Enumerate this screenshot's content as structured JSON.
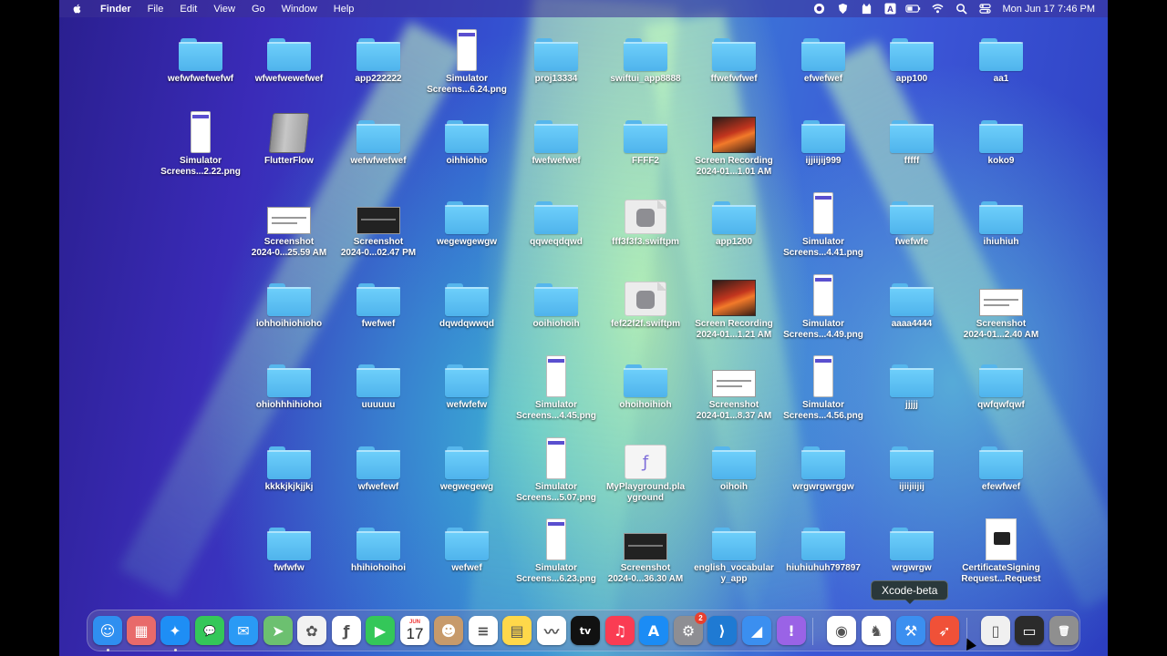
{
  "menubar": {
    "app_name": "Finder",
    "menus": [
      "File",
      "Edit",
      "View",
      "Go",
      "Window",
      "Help"
    ],
    "status_icons": [
      "record-icon",
      "shield-icon",
      "cat-icon",
      "input-source-icon",
      "battery-icon",
      "wifi-icon",
      "search-icon",
      "control-center-icon"
    ],
    "input_source": "A",
    "clock": "Mon Jun 17  7:46 PM"
  },
  "desktop": {
    "items": [
      {
        "label": "wefwfwefwefwf",
        "kind": "folder"
      },
      {
        "label": "wfwefwewefwef",
        "kind": "folder"
      },
      {
        "label": "app222222",
        "kind": "folder"
      },
      {
        "label": "Simulator\nScreens...6.24.png",
        "kind": "phone"
      },
      {
        "label": "proj13334",
        "kind": "folder"
      },
      {
        "label": "swiftui_app8888",
        "kind": "folder"
      },
      {
        "label": "ffwefwfwef",
        "kind": "folder"
      },
      {
        "label": "efwefwef",
        "kind": "folder"
      },
      {
        "label": "app100",
        "kind": "folder"
      },
      {
        "label": "aa1",
        "kind": "folder"
      },
      {
        "label": "Simulator\nScreens...2.22.png",
        "kind": "phone"
      },
      {
        "label": "FlutterFlow",
        "kind": "drive"
      },
      {
        "label": "wefwfwefwef",
        "kind": "folder"
      },
      {
        "label": "oihhiohio",
        "kind": "folder"
      },
      {
        "label": "fwefwefwef",
        "kind": "folder"
      },
      {
        "label": "FFFF2",
        "kind": "folder"
      },
      {
        "label": "Screen Recording\n2024-01...1.01 AM",
        "kind": "recording"
      },
      {
        "label": "ijjiijij999",
        "kind": "folder"
      },
      {
        "label": "fffff",
        "kind": "folder"
      },
      {
        "label": "koko9",
        "kind": "folder"
      },
      {
        "label": "Screenshot\n2024-0...25.59 AM",
        "kind": "screenshot"
      },
      {
        "label": "Screenshot\n2024-0...02.47 PM",
        "kind": "screenshot-dark"
      },
      {
        "label": "wegewgewgw",
        "kind": "folder"
      },
      {
        "label": "qqweqdqwd",
        "kind": "folder"
      },
      {
        "label": "fff3f3f3.swiftpm",
        "kind": "swiftpm"
      },
      {
        "label": "app1200",
        "kind": "folder"
      },
      {
        "label": "Simulator\nScreens...4.41.png",
        "kind": "phone"
      },
      {
        "label": "fwefwfe",
        "kind": "folder"
      },
      {
        "label": "ihiuhiuh",
        "kind": "folder"
      },
      {
        "label": "iohhoihiohioho",
        "kind": "folder"
      },
      {
        "label": "fwefwef",
        "kind": "folder"
      },
      {
        "label": "dqwdqwwqd",
        "kind": "folder"
      },
      {
        "label": "ooihiohoih",
        "kind": "folder"
      },
      {
        "label": "fef22f2f.swiftpm",
        "kind": "swiftpm"
      },
      {
        "label": "Screen Recording\n2024-01...1.21 AM",
        "kind": "recording"
      },
      {
        "label": "Simulator\nScreens...4.49.png",
        "kind": "phone"
      },
      {
        "label": "aaaa4444",
        "kind": "folder"
      },
      {
        "label": "Screenshot\n2024-01...2.40 AM",
        "kind": "screenshot"
      },
      {
        "label": "ohiohhhihiohoi",
        "kind": "folder"
      },
      {
        "label": "uuuuuu",
        "kind": "folder"
      },
      {
        "label": "wefwfefw",
        "kind": "folder"
      },
      {
        "label": "Simulator\nScreens...4.45.png",
        "kind": "phone"
      },
      {
        "label": "ohoihoihioh",
        "kind": "folder"
      },
      {
        "label": "Screenshot\n2024-01...8.37 AM",
        "kind": "screenshot"
      },
      {
        "label": "Simulator\nScreens...4.56.png",
        "kind": "phone"
      },
      {
        "label": "jjjjj",
        "kind": "folder"
      },
      {
        "label": "qwfqwfqwf",
        "kind": "folder"
      },
      {
        "label": "kkkkjkjkjjkj",
        "kind": "folder"
      },
      {
        "label": "wfwefewf",
        "kind": "folder"
      },
      {
        "label": "wegwegewg",
        "kind": "folder"
      },
      {
        "label": "Simulator\nScreens...5.07.png",
        "kind": "phone"
      },
      {
        "label": "MyPlayground.pla\nyground",
        "kind": "playground"
      },
      {
        "label": "oihoih",
        "kind": "folder"
      },
      {
        "label": "wrgwrgwrggw",
        "kind": "folder"
      },
      {
        "label": "ijiijiijij",
        "kind": "folder"
      },
      {
        "label": "efewfwef",
        "kind": "folder"
      },
      {
        "label": "fwfwfw",
        "kind": "folder"
      },
      {
        "label": "hhihiohoihoi",
        "kind": "folder"
      },
      {
        "label": "wefwef",
        "kind": "folder"
      },
      {
        "label": "Simulator\nScreens...6.23.png",
        "kind": "phone"
      },
      {
        "label": "Screenshot\n2024-0...36.30 AM",
        "kind": "screenshot-dark"
      },
      {
        "label": "english_vocabular\ny_app",
        "kind": "folder"
      },
      {
        "label": "hiuhiuhuh797897",
        "kind": "folder"
      },
      {
        "label": "wrgwrgw",
        "kind": "folder"
      },
      {
        "label": "CertificateSigning\nRequest...Request",
        "kind": "certificate"
      }
    ]
  },
  "tooltip": "Xcode-beta",
  "dock": {
    "apps": [
      {
        "name": "finder-icon",
        "glyph": "☺",
        "color": "#2f8ff0",
        "running": true
      },
      {
        "name": "launchpad-icon",
        "glyph": "▦",
        "color": "#e86a6a",
        "running": false
      },
      {
        "name": "safari-icon",
        "glyph": "✦",
        "color": "#1e8ef5",
        "running": true
      },
      {
        "name": "messages-icon",
        "glyph": "💬",
        "color": "#34c759",
        "running": false
      },
      {
        "name": "mail-icon",
        "glyph": "✉",
        "color": "#2a9af5",
        "running": false
      },
      {
        "name": "maps-icon",
        "glyph": "➤",
        "color": "#6cc070",
        "running": false
      },
      {
        "name": "photos-icon",
        "glyph": "✿",
        "color": "#f2f2f2",
        "running": false
      },
      {
        "name": "freeform-icon",
        "glyph": "ƒ",
        "color": "#ffffff",
        "running": false
      },
      {
        "name": "facetime-icon",
        "glyph": "▶",
        "color": "#34c759",
        "running": false
      },
      {
        "name": "calendar-icon",
        "glyph": "17",
        "color": "#ffffff",
        "running": false,
        "month": "JUN"
      },
      {
        "name": "contacts-icon",
        "glyph": "☻",
        "color": "#c79a6b",
        "running": false
      },
      {
        "name": "reminders-icon",
        "glyph": "≡",
        "color": "#ffffff",
        "running": false
      },
      {
        "name": "notes-icon",
        "glyph": "▤",
        "color": "#ffd84a",
        "running": false
      },
      {
        "name": "freeform-board-icon",
        "glyph": "〰",
        "color": "#ffffff",
        "running": false
      },
      {
        "name": "apple-tv-icon",
        "glyph": "tv",
        "color": "#111111",
        "running": false
      },
      {
        "name": "music-icon",
        "glyph": "♫",
        "color": "#fa3c53",
        "running": false
      },
      {
        "name": "app-store-icon",
        "glyph": "A",
        "color": "#1b8cf5",
        "running": false
      },
      {
        "name": "system-settings-icon",
        "glyph": "⚙",
        "color": "#8e8e93",
        "running": false,
        "badge": "2"
      },
      {
        "name": "vscode-icon",
        "glyph": "⟩",
        "color": "#1f7ad3",
        "running": false
      },
      {
        "name": "flutterflow-icon",
        "glyph": "◢",
        "color": "#3b8ff0",
        "running": false
      },
      {
        "name": "feedback-icon",
        "glyph": "!",
        "color": "#9a63e6",
        "running": false
      },
      {
        "name": "chrome-icon",
        "glyph": "◉",
        "color": "#ffffff",
        "running": false
      },
      {
        "name": "cat-app-icon",
        "glyph": "♞",
        "color": "#ffffff",
        "running": false
      },
      {
        "name": "xcode-beta-icon",
        "glyph": "⚒",
        "color": "#3b8ff0",
        "running": false
      },
      {
        "name": "swift-playgrounds-icon",
        "glyph": "➶",
        "color": "#f05138",
        "running": false
      },
      {
        "name": "document-stack-icon",
        "glyph": "▯",
        "color": "#f0f0f0",
        "running": false
      },
      {
        "name": "downloads-stack-icon",
        "glyph": "▭",
        "color": "#2b2b2b",
        "running": false
      },
      {
        "name": "trash-icon",
        "glyph": "🗑",
        "color": "#8f8f8f",
        "running": false
      }
    ]
  }
}
